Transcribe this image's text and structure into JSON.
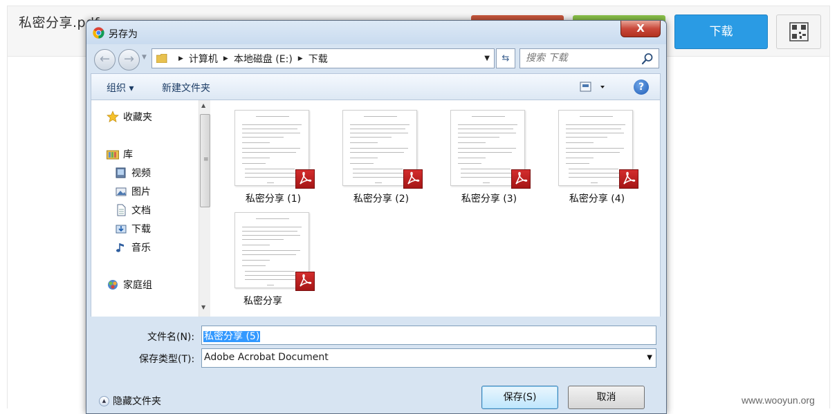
{
  "background": {
    "filename": "私密分享.pdf",
    "download_button": "下载",
    "watermark": "www.wooyun.org"
  },
  "dialog": {
    "title": "另存为",
    "close_label": "X",
    "address": {
      "crumbs": [
        "计算机",
        "本地磁盘 (E:)",
        "下载"
      ]
    },
    "search": {
      "placeholder": "搜索 下载"
    },
    "toolbar": {
      "organize": "组织 ▾",
      "new_folder": "新建文件夹",
      "help": "?"
    },
    "nav": {
      "favorites": "收藏夹",
      "libraries": "库",
      "videos": "视频",
      "pictures": "图片",
      "documents": "文档",
      "downloads": "下载",
      "music": "音乐",
      "homegroup": "家庭组"
    },
    "files": [
      {
        "name": "私密分享 (1)"
      },
      {
        "name": "私密分享 (2)"
      },
      {
        "name": "私密分享 (3)"
      },
      {
        "name": "私密分享 (4)"
      },
      {
        "name": "私密分享"
      }
    ],
    "form": {
      "filename_label": "文件名(N):",
      "filename_value": "私密分享 (5)",
      "filetype_label": "保存类型(T):",
      "filetype_value": "Adobe Acrobat Document",
      "hide_folders": "隐藏文件夹",
      "save": "保存(S)",
      "cancel": "取消"
    }
  },
  "colors": {
    "download_button": "#2a9be4",
    "pdf_badge": "#c21f1f",
    "selection": "#3399ff"
  }
}
